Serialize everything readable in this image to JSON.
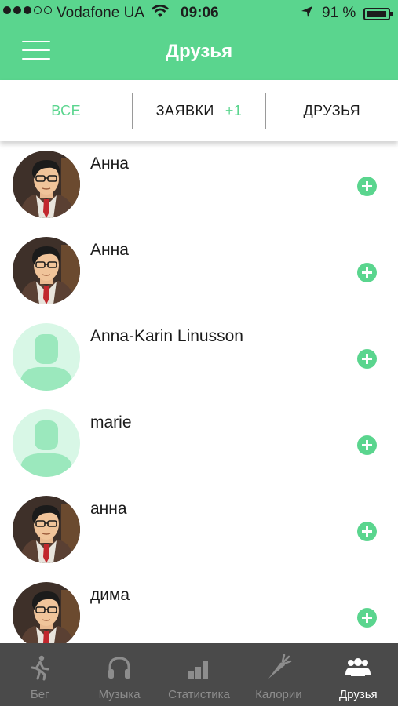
{
  "status_bar": {
    "carrier": "Vodafone UA",
    "time": "09:06",
    "battery": "91 %",
    "signal_dots": 5,
    "signal_filled": 3
  },
  "nav": {
    "title": "Друзья",
    "menu_icon": "hamburger-menu-icon"
  },
  "tabs": [
    {
      "label": "ВСЕ",
      "active": true
    },
    {
      "label": "ЗАЯВКИ",
      "badge": "+1",
      "active": false
    },
    {
      "label": "ДРУЗЬЯ",
      "active": false
    }
  ],
  "people": [
    {
      "name": "Анна",
      "avatar": "cartoon-portrait"
    },
    {
      "name": "Анна",
      "avatar": "cartoon-portrait"
    },
    {
      "name": "Anna-Karin Linusson",
      "avatar": "default-placeholder"
    },
    {
      "name": "marie",
      "avatar": "default-placeholder"
    },
    {
      "name": "анна",
      "avatar": "cartoon-portrait"
    },
    {
      "name": "дима",
      "avatar": "cartoon-portrait"
    }
  ],
  "tabbar": [
    {
      "label": "Бег",
      "icon": "runner-icon",
      "active": false
    },
    {
      "label": "Музыка",
      "icon": "headphones-icon",
      "active": false
    },
    {
      "label": "Статистика",
      "icon": "bar-chart-icon",
      "active": false
    },
    {
      "label": "Калории",
      "icon": "carrot-icon",
      "active": false
    },
    {
      "label": "Друзья",
      "icon": "friends-icon",
      "active": true
    }
  ],
  "colors": {
    "accent": "#5ad58e",
    "tabbar_bg": "#4a4a4a",
    "placeholder_bg": "#d8f7e6",
    "placeholder_fg": "#9be8bd"
  }
}
